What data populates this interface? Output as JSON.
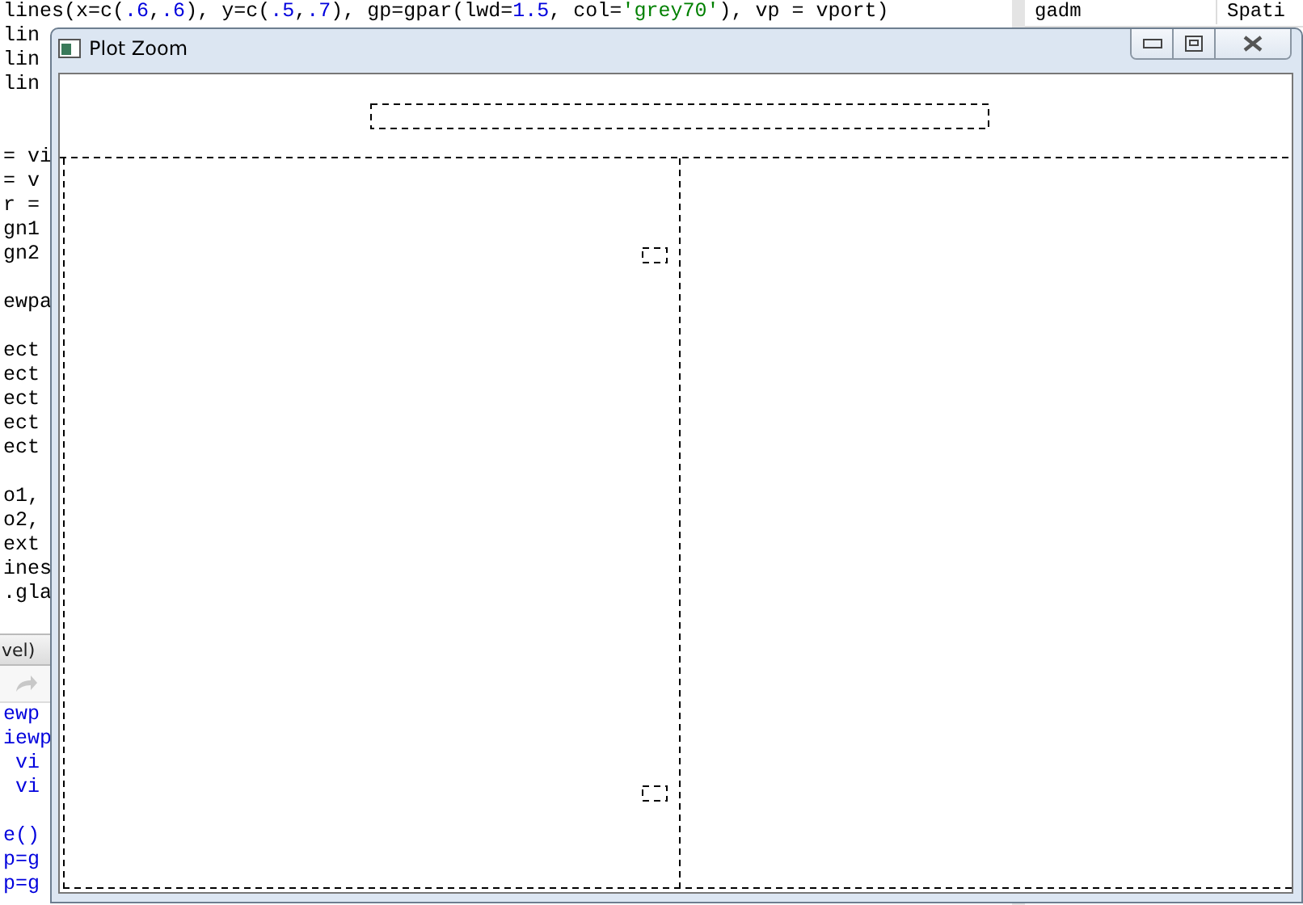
{
  "editor": {
    "first_line": [
      {
        "text": "lines(x=c(",
        "kind": "plain"
      },
      {
        "text": ".6",
        "kind": "number"
      },
      {
        "text": ",",
        "kind": "plain"
      },
      {
        "text": ".6",
        "kind": "number"
      },
      {
        "text": "), y=c(",
        "kind": "plain"
      },
      {
        "text": ".5",
        "kind": "number"
      },
      {
        "text": ",",
        "kind": "plain"
      },
      {
        "text": ".7",
        "kind": "number"
      },
      {
        "text": "), gp=gpar(lwd=",
        "kind": "plain"
      },
      {
        "text": "1.5",
        "kind": "number"
      },
      {
        "text": ", col=",
        "kind": "plain"
      },
      {
        "text": "'grey70'",
        "kind": "string"
      },
      {
        "text": "), vp = vport)",
        "kind": "plain"
      }
    ],
    "fragments": [
      {
        "text": "lin",
        "kind": "plain"
      },
      {
        "text": "lin",
        "kind": "plain"
      },
      {
        "text": "lin",
        "kind": "plain"
      },
      {
        "kind": "blank"
      },
      {
        "kind": "blank"
      },
      {
        "text": "= vi",
        "kind": "plain"
      },
      {
        "text": "= v",
        "kind": "plain"
      },
      {
        "text": "r =",
        "kind": "plain"
      },
      {
        "text": "gn1",
        "kind": "plain"
      },
      {
        "text": "gn2",
        "kind": "plain"
      },
      {
        "kind": "blank"
      },
      {
        "text": "ewpa",
        "kind": "plain"
      },
      {
        "kind": "blank"
      },
      {
        "text": "ect",
        "kind": "plain"
      },
      {
        "text": "ect",
        "kind": "plain"
      },
      {
        "text": "ect",
        "kind": "plain"
      },
      {
        "text": "ect",
        "kind": "plain"
      },
      {
        "text": "ect",
        "kind": "plain"
      },
      {
        "kind": "blank"
      },
      {
        "text": "o1,",
        "kind": "plain"
      },
      {
        "text": "o2,",
        "kind": "plain"
      },
      {
        "text": "ext",
        "kind": "plain"
      },
      {
        "text": "ines",
        "kind": "plain"
      },
      {
        "text": ".gla",
        "kind": "plain"
      }
    ]
  },
  "console": {
    "label": "vel)",
    "fragments": [
      {
        "text": "ewp",
        "kind": "call"
      },
      {
        "text": "iewp",
        "kind": "call"
      },
      {
        "text": " vi",
        "kind": "call"
      },
      {
        "text": " vi",
        "kind": "call"
      },
      {
        "kind": "blank"
      },
      {
        "text": "e()",
        "kind": "call"
      },
      {
        "text": "p=g",
        "kind": "call"
      },
      {
        "text": "p=g",
        "kind": "call"
      }
    ]
  },
  "environment": {
    "columns": [
      "gadm",
      "Spati"
    ]
  },
  "window": {
    "title": "Plot Zoom"
  }
}
